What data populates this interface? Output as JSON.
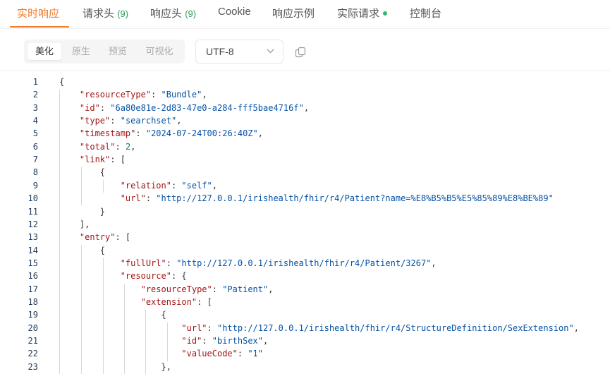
{
  "tabs": [
    {
      "label": "实时响应",
      "count": ""
    },
    {
      "label": "请求头",
      "count": "(9)"
    },
    {
      "label": "响应头",
      "count": "(9)"
    },
    {
      "label": "Cookie",
      "count": ""
    },
    {
      "label": "响应示例",
      "count": ""
    },
    {
      "label": "实际请求",
      "count": ""
    },
    {
      "label": "控制台",
      "count": ""
    }
  ],
  "view_modes": [
    "美化",
    "原生",
    "预览",
    "可视化"
  ],
  "active_view_mode": "美化",
  "encoding": "UTF-8",
  "colors": {
    "accent": "#f07c2a",
    "count": "#2e9d5a",
    "key": "#a31515",
    "string": "#0451a5",
    "number": "#098658"
  },
  "code_lines": [
    {
      "n": "1",
      "t": [
        {
          "c": "p",
          "v": "{"
        }
      ]
    },
    {
      "n": "2",
      "t": [
        {
          "c": "p",
          "v": "    "
        },
        {
          "c": "k",
          "v": "\"resourceType\""
        },
        {
          "c": "p",
          "v": ": "
        },
        {
          "c": "s",
          "v": "\"Bundle\""
        },
        {
          "c": "p",
          "v": ","
        }
      ]
    },
    {
      "n": "3",
      "t": [
        {
          "c": "p",
          "v": "    "
        },
        {
          "c": "k",
          "v": "\"id\""
        },
        {
          "c": "p",
          "v": ": "
        },
        {
          "c": "s",
          "v": "\"6a80e81e-2d83-47e0-a284-fff5bae4716f\""
        },
        {
          "c": "p",
          "v": ","
        }
      ]
    },
    {
      "n": "4",
      "t": [
        {
          "c": "p",
          "v": "    "
        },
        {
          "c": "k",
          "v": "\"type\""
        },
        {
          "c": "p",
          "v": ": "
        },
        {
          "c": "s",
          "v": "\"searchset\""
        },
        {
          "c": "p",
          "v": ","
        }
      ]
    },
    {
      "n": "5",
      "t": [
        {
          "c": "p",
          "v": "    "
        },
        {
          "c": "k",
          "v": "\"timestamp\""
        },
        {
          "c": "p",
          "v": ": "
        },
        {
          "c": "s",
          "v": "\"2024-07-24T00:26:40Z\""
        },
        {
          "c": "p",
          "v": ","
        }
      ]
    },
    {
      "n": "6",
      "t": [
        {
          "c": "p",
          "v": "    "
        },
        {
          "c": "k",
          "v": "\"total\""
        },
        {
          "c": "p",
          "v": ": "
        },
        {
          "c": "n",
          "v": "2"
        },
        {
          "c": "p",
          "v": ","
        }
      ]
    },
    {
      "n": "7",
      "t": [
        {
          "c": "p",
          "v": "    "
        },
        {
          "c": "k",
          "v": "\"link\""
        },
        {
          "c": "p",
          "v": ": ["
        }
      ]
    },
    {
      "n": "8",
      "t": [
        {
          "c": "p",
          "v": "        {"
        }
      ]
    },
    {
      "n": "9",
      "t": [
        {
          "c": "p",
          "v": "            "
        },
        {
          "c": "k",
          "v": "\"relation\""
        },
        {
          "c": "p",
          "v": ": "
        },
        {
          "c": "s",
          "v": "\"self\""
        },
        {
          "c": "p",
          "v": ","
        }
      ]
    },
    {
      "n": "10",
      "t": [
        {
          "c": "p",
          "v": "            "
        },
        {
          "c": "k",
          "v": "\"url\""
        },
        {
          "c": "p",
          "v": ": "
        },
        {
          "c": "s",
          "v": "\"http://127.0.0.1/irishealth/fhir/r4/Patient?name=%E8%B5%B5%E5%85%89%E8%BE%89\""
        }
      ]
    },
    {
      "n": "11",
      "t": [
        {
          "c": "p",
          "v": "        }"
        }
      ]
    },
    {
      "n": "12",
      "t": [
        {
          "c": "p",
          "v": "    ],"
        }
      ]
    },
    {
      "n": "13",
      "t": [
        {
          "c": "p",
          "v": "    "
        },
        {
          "c": "k",
          "v": "\"entry\""
        },
        {
          "c": "p",
          "v": ": ["
        }
      ]
    },
    {
      "n": "14",
      "t": [
        {
          "c": "p",
          "v": "        {"
        }
      ]
    },
    {
      "n": "15",
      "t": [
        {
          "c": "p",
          "v": "            "
        },
        {
          "c": "k",
          "v": "\"fullUrl\""
        },
        {
          "c": "p",
          "v": ": "
        },
        {
          "c": "s",
          "v": "\"http://127.0.0.1/irishealth/fhir/r4/Patient/3267\""
        },
        {
          "c": "p",
          "v": ","
        }
      ]
    },
    {
      "n": "16",
      "t": [
        {
          "c": "p",
          "v": "            "
        },
        {
          "c": "k",
          "v": "\"resource\""
        },
        {
          "c": "p",
          "v": ": {"
        }
      ]
    },
    {
      "n": "17",
      "t": [
        {
          "c": "p",
          "v": "                "
        },
        {
          "c": "k",
          "v": "\"resourceType\""
        },
        {
          "c": "p",
          "v": ": "
        },
        {
          "c": "s",
          "v": "\"Patient\""
        },
        {
          "c": "p",
          "v": ","
        }
      ]
    },
    {
      "n": "18",
      "t": [
        {
          "c": "p",
          "v": "                "
        },
        {
          "c": "k",
          "v": "\"extension\""
        },
        {
          "c": "p",
          "v": ": ["
        }
      ]
    },
    {
      "n": "19",
      "t": [
        {
          "c": "p",
          "v": "                    {"
        }
      ]
    },
    {
      "n": "20",
      "t": [
        {
          "c": "p",
          "v": "                        "
        },
        {
          "c": "k",
          "v": "\"url\""
        },
        {
          "c": "p",
          "v": ": "
        },
        {
          "c": "s",
          "v": "\"http://127.0.0.1/irishealth/fhir/r4/StructureDefinition/SexExtension\""
        },
        {
          "c": "p",
          "v": ","
        }
      ]
    },
    {
      "n": "21",
      "t": [
        {
          "c": "p",
          "v": "                        "
        },
        {
          "c": "k",
          "v": "\"id\""
        },
        {
          "c": "p",
          "v": ": "
        },
        {
          "c": "s",
          "v": "\"birthSex\""
        },
        {
          "c": "p",
          "v": ","
        }
      ]
    },
    {
      "n": "22",
      "t": [
        {
          "c": "p",
          "v": "                        "
        },
        {
          "c": "k",
          "v": "\"valueCode\""
        },
        {
          "c": "p",
          "v": ": "
        },
        {
          "c": "s",
          "v": "\"1\""
        }
      ]
    },
    {
      "n": "23",
      "t": [
        {
          "c": "p",
          "v": "                    },"
        }
      ]
    }
  ]
}
